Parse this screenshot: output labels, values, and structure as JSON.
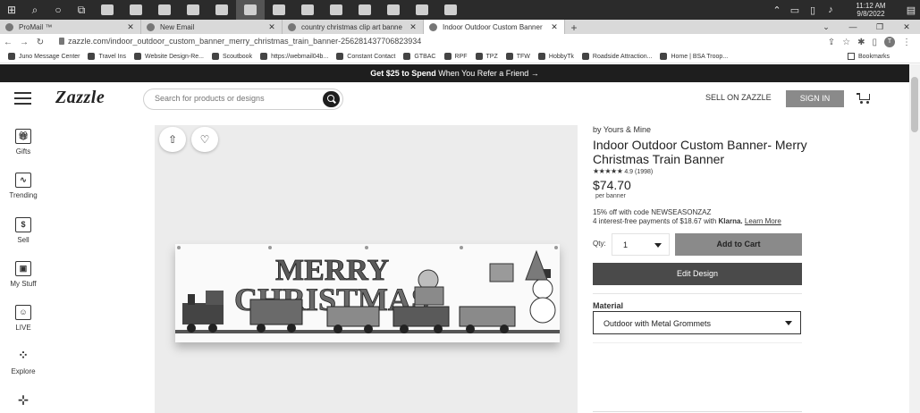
{
  "taskbar": {
    "clock_time": "11:12 AM",
    "clock_date": "9/8/2022",
    "apps": [
      "mail-app",
      "music-app",
      "file-app",
      "photo-app",
      "app-5",
      "app-6",
      "app-7",
      "app-8",
      "chrome-app",
      "word-app",
      "app-11",
      "app-12",
      "app-13",
      "acrobat-app"
    ]
  },
  "browser": {
    "tabs": [
      {
        "title": "ProMail ™",
        "active": false
      },
      {
        "title": "New Email",
        "active": false
      },
      {
        "title": "country christmas clip art banne",
        "active": false
      },
      {
        "title": "Indoor Outdoor Custom Banner",
        "active": true
      }
    ],
    "url": "zazzle.com/indoor_outdoor_custom_banner_merry_christmas_train_banner-256281437706823934",
    "profile_initial": "T",
    "bookmarks": [
      "Juno Message Center",
      "Travel Ins",
      "Website Design-Re...",
      "Scoutbook",
      "https://webmail04b...",
      "Constant Contact",
      "GTBAC",
      "RPF",
      "TPZ",
      "TFW",
      "HobbyTk",
      "Roadside Attraction...",
      "Home | BSA Troop..."
    ],
    "other_bookmarks": "Bookmarks"
  },
  "promo": {
    "bold": "Get $25 to Spend",
    "rest": " When You Refer a Friend →"
  },
  "header": {
    "logo": "Zazzle",
    "search_placeholder": "Search for products or designs",
    "sell_label": "SELL ON ZAZZLE",
    "signin_label": "SIGN IN"
  },
  "sidebar": {
    "items": [
      {
        "label": "Gifts",
        "icon": "gift-icon"
      },
      {
        "label": "Trending",
        "icon": "trending-icon"
      },
      {
        "label": "Sell",
        "icon": "dollar-icon"
      },
      {
        "label": "My Stuff",
        "icon": "my-stuff-icon"
      },
      {
        "label": "LIVE",
        "icon": "live-icon"
      },
      {
        "label": "Explore",
        "icon": "explore-icon"
      }
    ]
  },
  "product": {
    "byline": "by Yours & Mine",
    "title": "Indoor Outdoor Custom Banner- Merry Christmas Train Banner",
    "rating": "4.9",
    "rating_count": "(1998)",
    "rating_text": "4.9 (1998)",
    "price": "$74.70",
    "per_unit": "per banner",
    "promo_code_line": "15% off with code NEWSEASONZAZ",
    "installment_prefix": "4 interest-free payments of $18.67 with",
    "klarna": "Klarna.",
    "learn_more": "Learn More",
    "qty_label": "Qty:",
    "qty_value": "1",
    "add_to_cart": "Add to Cart",
    "edit_design": "Edit Design",
    "material_label": "Material",
    "material_value": "Outdoor with Metal Grommets",
    "banner_line1": "MERRY",
    "banner_line2": "CHRISTMAS"
  }
}
